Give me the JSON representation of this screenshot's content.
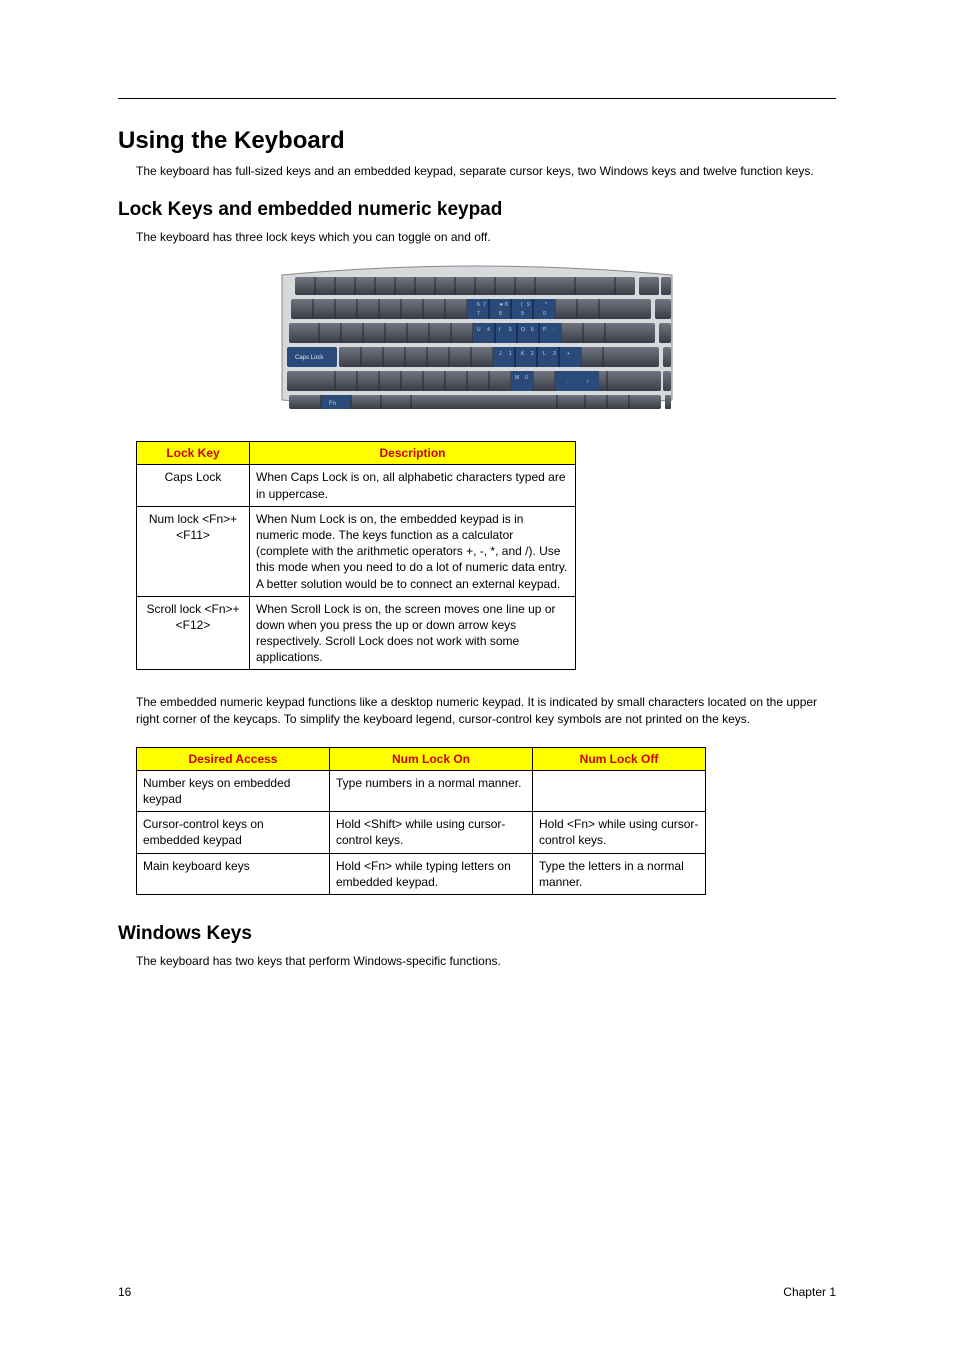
{
  "section_title": "Using the Keyboard",
  "intro_text": "The keyboard has full-sized keys and an embedded keypad, separate cursor keys, two Windows keys and twelve function keys.",
  "sub1": {
    "title": "Lock Keys and embedded numeric keypad",
    "text": "The keyboard has three lock keys which you can toggle on and off."
  },
  "lock_table": {
    "headers": [
      "Lock Key",
      "Description"
    ],
    "rows": [
      {
        "key": "Caps Lock",
        "desc": "When Caps Lock is on, all alphabetic characters typed are in uppercase."
      },
      {
        "key": "Num lock <Fn>+<F11>",
        "desc": "When Num Lock is on, the embedded keypad is in numeric mode. The keys function as a calculator (complete with the arithmetic operators +, -, *, and /). Use this mode when you need to do a lot of numeric data entry. A better solution would be to connect an external keypad."
      },
      {
        "key": "Scroll lock <Fn>+<F12>",
        "desc": "When Scroll Lock is on, the screen moves one line up or down when you press the up or down arrow keys respectively. Scroll Lock does not work with some applications."
      }
    ]
  },
  "numpad_text": "The embedded numeric keypad functions like a desktop numeric keypad. It is indicated by small characters located on the upper right corner of the keycaps. To simplify the keyboard legend, cursor-control key symbols are not printed on the keys.",
  "access_table": {
    "headers": [
      "Desired Access",
      "Num Lock On",
      "Num Lock Off"
    ],
    "rows": [
      {
        "c0": "Number keys on embedded keypad",
        "c1": "Type numbers in a normal manner.",
        "c2": ""
      },
      {
        "c0": "Cursor-control keys on embedded keypad",
        "c1": "Hold <Shift> while using cursor-control keys.",
        "c2": "Hold <Fn> while using cursor-control keys."
      },
      {
        "c0": "Main keyboard keys",
        "c1": "Hold <Fn> while typing letters on embedded keypad.",
        "c2": "Type the letters in a normal manner."
      }
    ]
  },
  "sub2": {
    "title": "Windows Keys",
    "text": "The keyboard has two keys that perform Windows-specific functions."
  },
  "footer": {
    "page": "16",
    "chapter": "Chapter 1"
  },
  "kb_image_label": "keyboard-illustration"
}
